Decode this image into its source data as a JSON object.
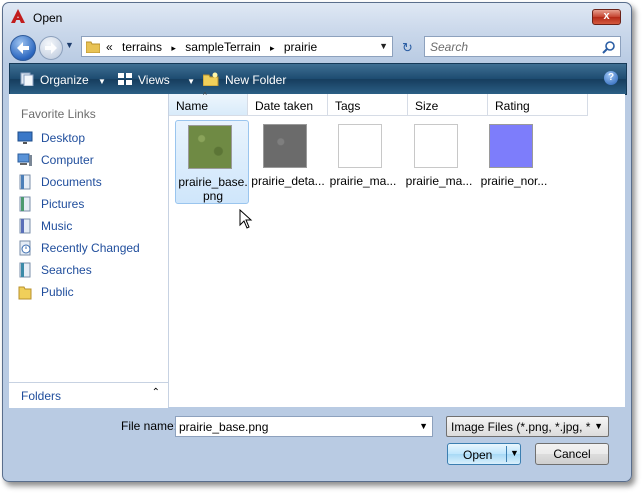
{
  "window": {
    "title": "Open",
    "close_label": "x"
  },
  "nav": {
    "breadcrumbs": [
      "«",
      "terrains",
      "▸",
      "sampleTerrain",
      "▸",
      "prairie"
    ],
    "search_placeholder": "Search",
    "dropdown_glyph": "▼",
    "refresh_glyph": "↻"
  },
  "toolbar": {
    "organize": "Organize",
    "views": "Views",
    "new_folder": "New Folder",
    "dropdown_glyph": "▼",
    "help": "?"
  },
  "sidebar": {
    "heading": "Favorite Links",
    "items": [
      {
        "label": "Desktop",
        "icon": "desktop-icon"
      },
      {
        "label": "Computer",
        "icon": "computer-icon"
      },
      {
        "label": "Documents",
        "icon": "documents-icon"
      },
      {
        "label": "Pictures",
        "icon": "pictures-icon"
      },
      {
        "label": "Music",
        "icon": "music-icon"
      },
      {
        "label": "Recently Changed",
        "icon": "recent-icon"
      },
      {
        "label": "Searches",
        "icon": "searches-icon"
      },
      {
        "label": "Public",
        "icon": "public-folder-icon"
      }
    ],
    "folders_label": "Folders",
    "folders_chevron": "⌃"
  },
  "columns": [
    "Name",
    "Date taken",
    "Tags",
    "Size",
    "Rating"
  ],
  "files": [
    {
      "name": "prairie_base.png",
      "line1": "prairie_base.",
      "line2": "png",
      "thumb_color": "#6f8a44",
      "selected": true
    },
    {
      "name": "prairie_deta...",
      "line1": "prairie_deta...",
      "line2": "",
      "thumb_color": "#6b6b6b",
      "selected": false
    },
    {
      "name": "prairie_ma...",
      "line1": "prairie_ma...",
      "line2": "",
      "thumb_color": "#ffffff",
      "selected": false
    },
    {
      "name": "prairie_ma...",
      "line1": "prairie_ma...",
      "line2": "",
      "thumb_color": "#ffffff",
      "selected": false
    },
    {
      "name": "prairie_nor...",
      "line1": "prairie_nor...",
      "line2": "",
      "thumb_color": "#7d7dfb",
      "selected": false
    }
  ],
  "bottom": {
    "file_name_label": "File name:",
    "file_name_value": "prairie_base.png",
    "file_type": "Image Files (*.png, *.jpg, *.dds",
    "open_label": "Open",
    "cancel_label": "Cancel",
    "dropdown_glyph": "▼"
  }
}
